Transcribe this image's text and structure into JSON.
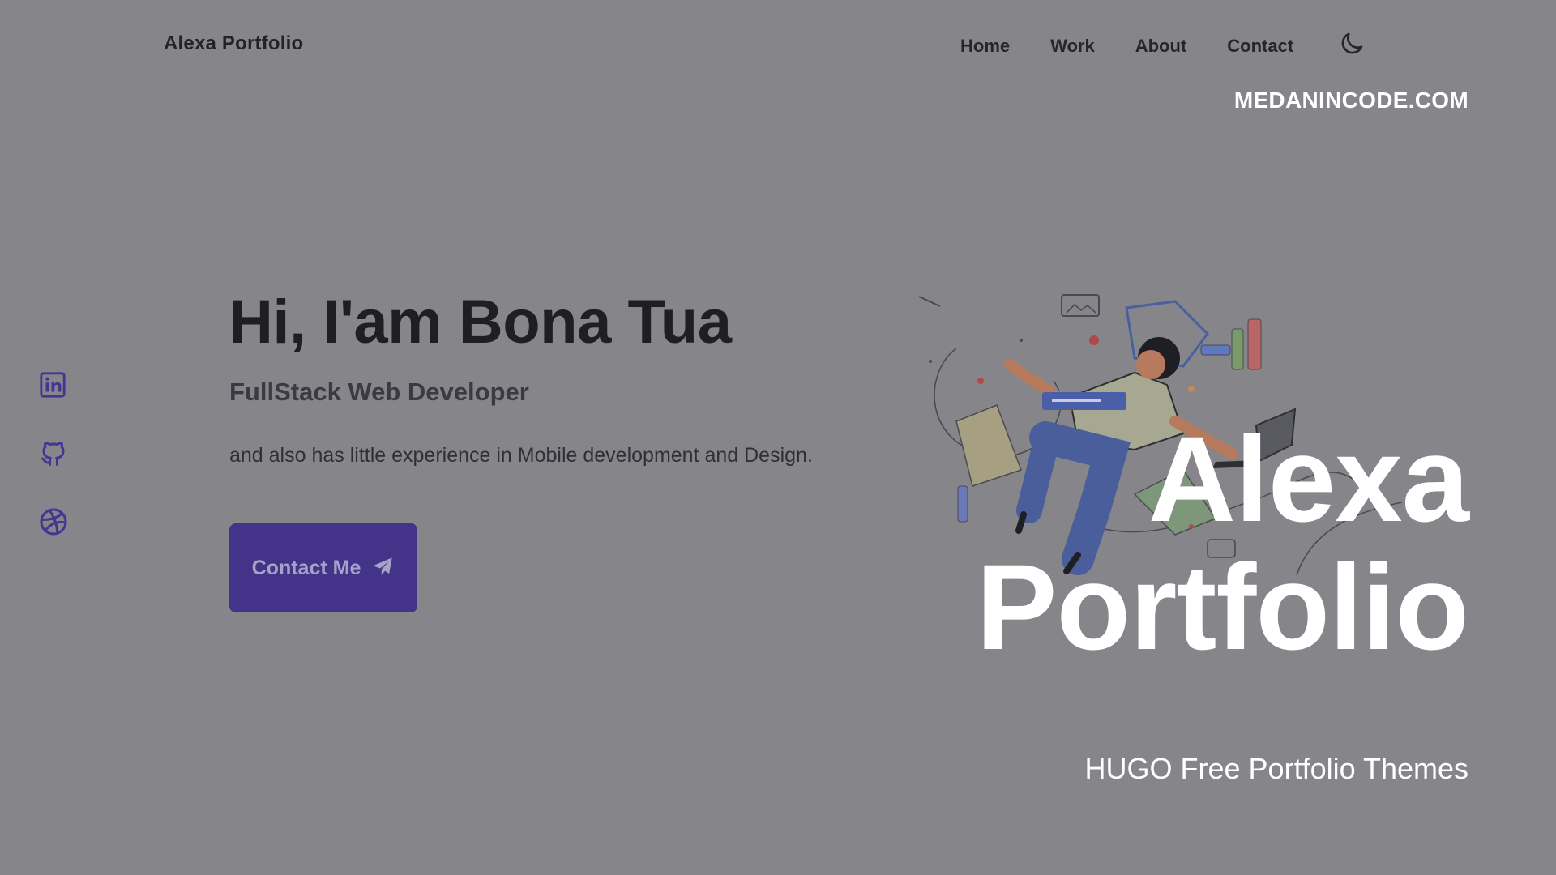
{
  "header": {
    "brand": "Alexa Portfolio",
    "nav": [
      "Home",
      "Work",
      "About",
      "Contact"
    ],
    "theme_icon": "moon-icon"
  },
  "site_tag": "MEDANINCODE.COM",
  "social": [
    {
      "icon": "linkedin-icon"
    },
    {
      "icon": "github-icon"
    },
    {
      "icon": "dribbble-icon"
    }
  ],
  "hero": {
    "title": "Hi, I'am Bona Tua",
    "role": "FullStack Web Developer",
    "description": "and also has little experience in Mobile development and Design.",
    "cta_label": "Contact Me",
    "cta_icon": "paper-plane-icon",
    "illustration": "developer-illustration"
  },
  "overlay": {
    "title_line1": "Alexa",
    "title_line2": "Portfolio",
    "subtitle": "HUGO Free Portfolio Themes"
  },
  "colors": {
    "background": "#86868a",
    "accent": "#433389",
    "overlay_text": "#ffffff"
  }
}
